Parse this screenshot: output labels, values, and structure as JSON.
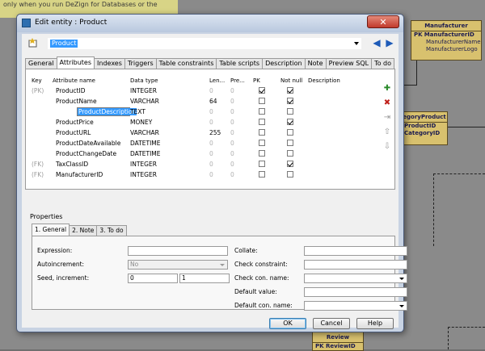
{
  "background": {
    "hint_text": "only when you run DeZign for Databases or the",
    "entities": {
      "manufacturer": {
        "title": "Manufacturer",
        "pk": "PK",
        "rows": [
          "ManufacturerID",
          "ManufacturerName",
          "ManufacturerLogo"
        ]
      },
      "category_product": {
        "title": "egoryProduct",
        "rows": [
          "ProductID",
          "CategoryID"
        ]
      },
      "review": {
        "title": "Review",
        "rows": [
          "PK  ReviewID"
        ]
      }
    }
  },
  "dialog": {
    "title": "Edit entity : Product",
    "close_label": "✕",
    "entity_selected": "Product",
    "tabs": [
      "General",
      "Attributes",
      "Indexes",
      "Triggers",
      "Table constraints",
      "Table scripts",
      "Description",
      "Note",
      "Preview SQL",
      "To do"
    ],
    "active_tab": "Attributes",
    "grid": {
      "headers": [
        "Key",
        "Attribute name",
        "Data type",
        "Len...",
        "Pre...",
        "PK",
        "Not null",
        "Description"
      ],
      "rows": [
        {
          "key": "(PK)",
          "name": "ProductID",
          "type": "INTEGER",
          "len": "0",
          "pre": "0",
          "pk": true,
          "notnull": true
        },
        {
          "key": "",
          "name": "ProductName",
          "type": "VARCHAR",
          "len": "64",
          "pre": "0",
          "pk": false,
          "notnull": true
        },
        {
          "key": "",
          "name": "ProductDescription",
          "type": "TEXT",
          "len": "0",
          "pre": "0",
          "pk": false,
          "notnull": false,
          "editing": true
        },
        {
          "key": "",
          "name": "ProductPrice",
          "type": "MONEY",
          "len": "0",
          "pre": "0",
          "pk": false,
          "notnull": true
        },
        {
          "key": "",
          "name": "ProductURL",
          "type": "VARCHAR",
          "len": "255",
          "pre": "0",
          "pk": false,
          "notnull": false
        },
        {
          "key": "",
          "name": "ProductDateAvailable",
          "type": "DATETIME",
          "len": "0",
          "pre": "0",
          "pk": false,
          "notnull": false
        },
        {
          "key": "",
          "name": "ProductChangeDate",
          "type": "DATETIME",
          "len": "0",
          "pre": "0",
          "pk": false,
          "notnull": false
        },
        {
          "key": "(FK)",
          "name": "TaxClassID",
          "type": "INTEGER",
          "len": "0",
          "pre": "0",
          "pk": false,
          "notnull": true
        },
        {
          "key": "(FK)",
          "name": "ManufacturerID",
          "type": "INTEGER",
          "len": "0",
          "pre": "0",
          "pk": false,
          "notnull": false
        }
      ]
    },
    "properties": {
      "label": "Properties",
      "tabs": [
        "1. General",
        "2. Note",
        "3. To do"
      ],
      "active_tab": "1. General",
      "fields": {
        "expression_label": "Expression:",
        "expression_value": "",
        "autoincrement_label": "Autoincrement:",
        "autoincrement_value": "No",
        "seed_label": "Seed, increment:",
        "seed_value": "0",
        "increment_value": "1",
        "collate_label": "Collate:",
        "collate_value": "",
        "check_constraint_label": "Check constraint:",
        "check_constraint_value": "",
        "check_con_name_label": "Check con. name:",
        "check_con_name_value": "",
        "default_value_label": "Default value:",
        "default_value_value": "",
        "default_con_name_label": "Default con. name:",
        "default_con_name_value": ""
      }
    },
    "buttons": {
      "ok": "OK",
      "cancel": "Cancel",
      "help": "Help"
    }
  }
}
